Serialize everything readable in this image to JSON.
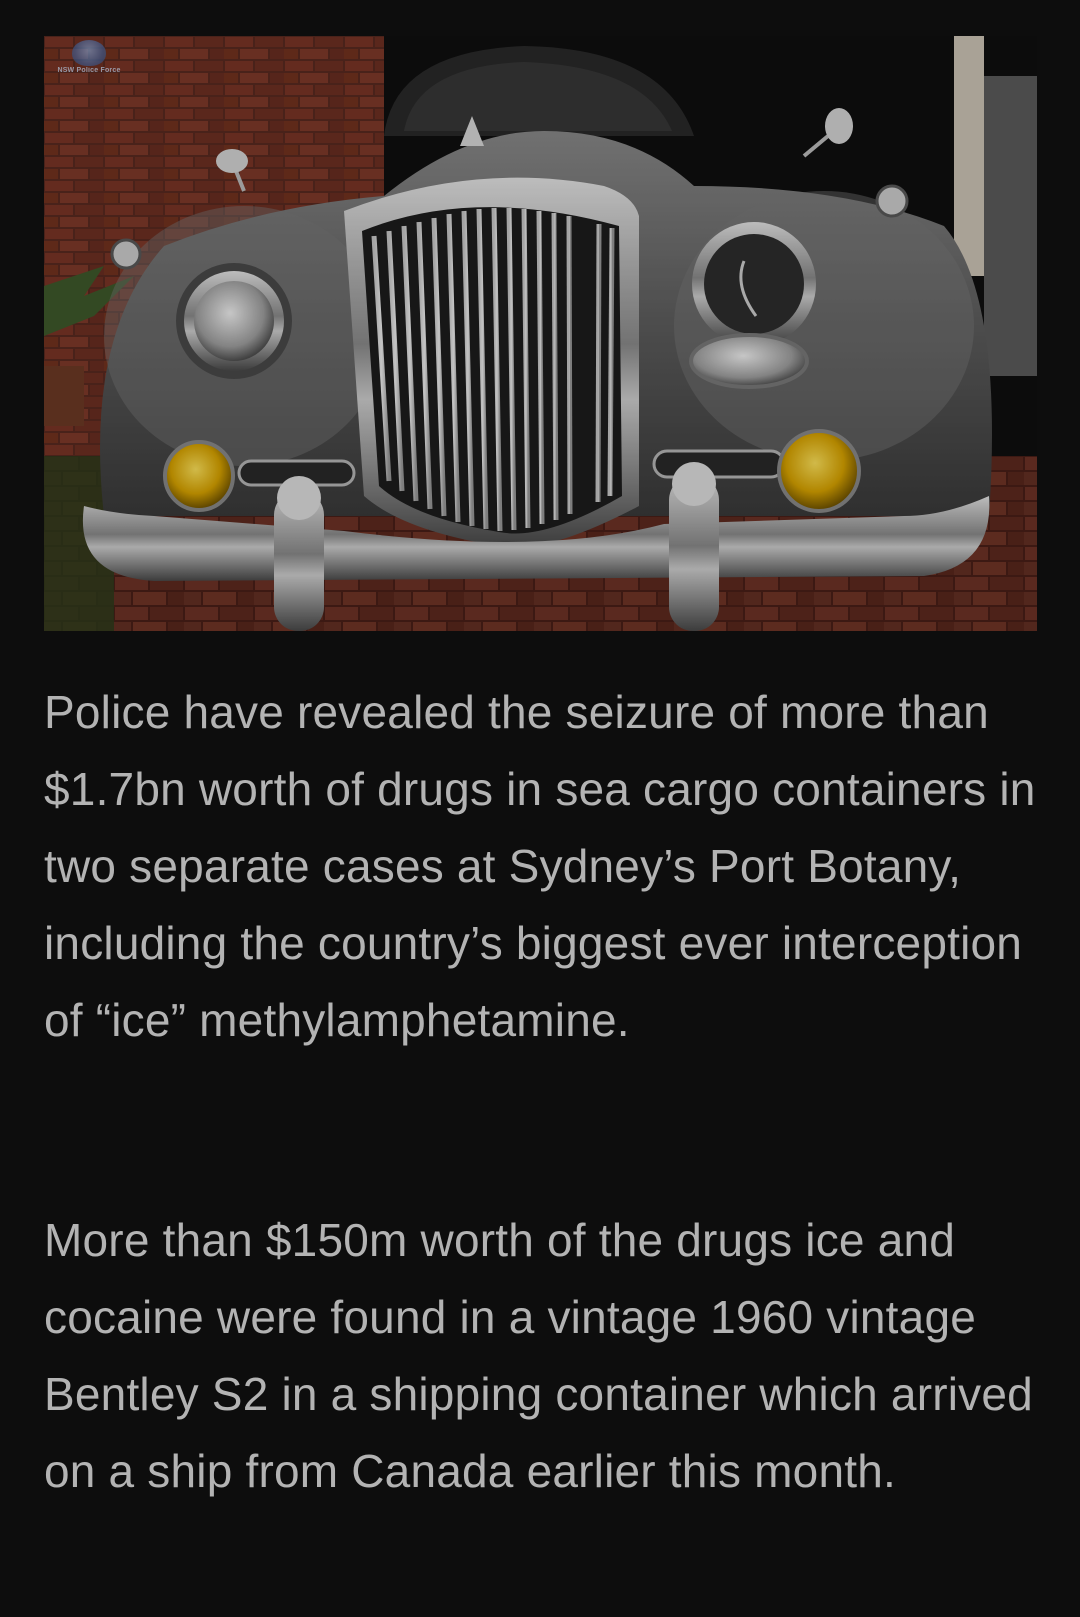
{
  "image": {
    "subject": "vintage-bentley-front",
    "watermark_text": "NSW Police Force"
  },
  "paragraphs": [
    "Police have revealed the seizure of more than $1.7bn worth of drugs in sea cargo containers in two separate cases at Sydney’s Port Botany, including the country’s biggest ever interception of “ice” methylamphetamine.",
    "More than $150m worth of the drugs ice and cocaine were found in a vintage 1960 vintage Bentley S2 in a shipping container which arrived on a ship from Canada earlier this month."
  ],
  "colors": {
    "background": "#0d0d0d",
    "text": "#b3b3b3",
    "car_body": "#6b6b6b",
    "fog_lights": "#d9a400",
    "brick": "#6b2e22"
  }
}
